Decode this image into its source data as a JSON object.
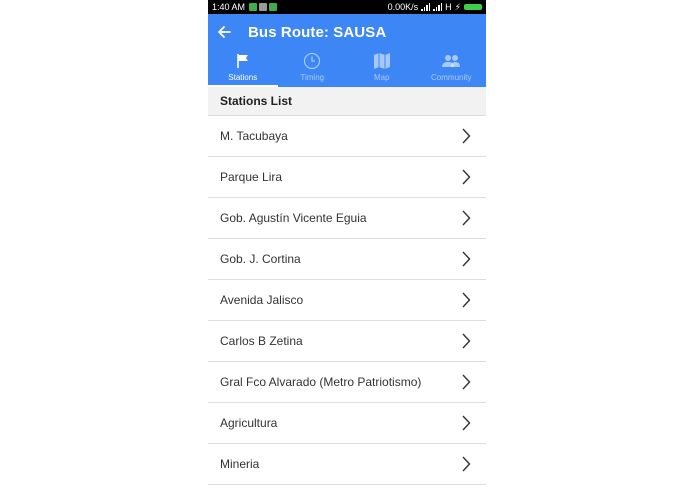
{
  "status_bar": {
    "time": "1:40 AM",
    "speed": "0.00K/s",
    "network": "H"
  },
  "app_bar": {
    "title": "Bus Route: SAUSA"
  },
  "tabs": [
    {
      "label": "Stations",
      "icon": "flag-icon",
      "active": true
    },
    {
      "label": "Timing",
      "icon": "clock-icon",
      "active": false
    },
    {
      "label": "Map",
      "icon": "map-icon",
      "active": false
    },
    {
      "label": "Community",
      "icon": "people-icon",
      "active": false
    }
  ],
  "section": {
    "title": "Stations List"
  },
  "stations": [
    "M. Tacubaya",
    "Parque Lira",
    "Gob. Agustín Vicente Eguia",
    "Gob. J. Cortina",
    "Avenida Jalisco",
    "Carlos B Zetina",
    "Gral Fco Alvarado (Metro Patriotismo)",
    "Agricultura",
    "Mineria"
  ],
  "colors": {
    "accent": "#3d86f5",
    "status_bar": "#000000",
    "section_bg": "#f2f2f2"
  }
}
